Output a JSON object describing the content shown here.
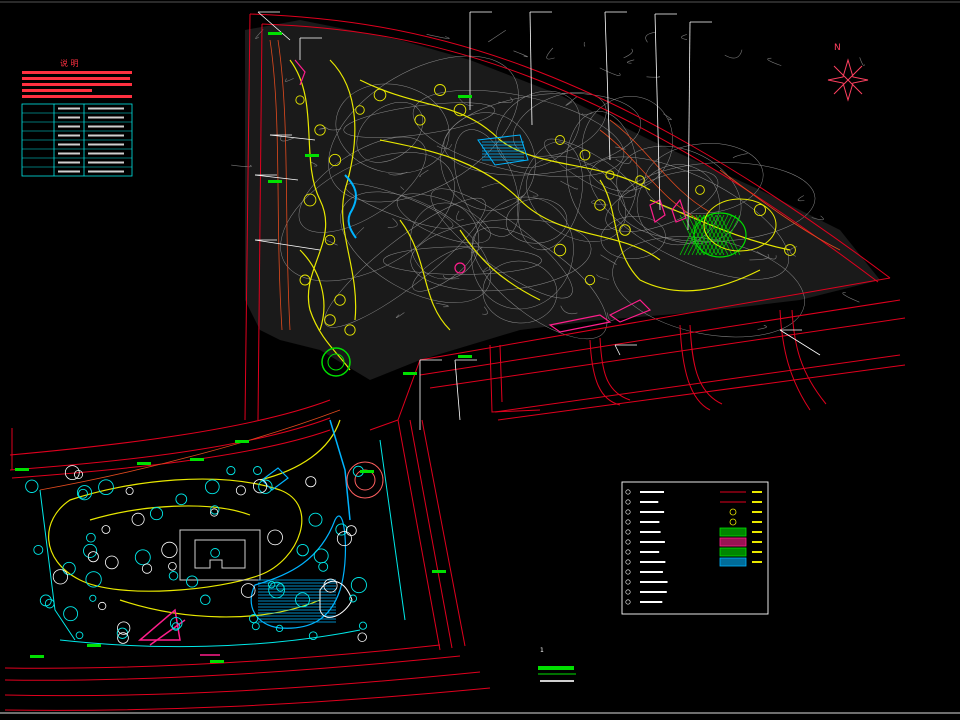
{
  "drawing": {
    "north_label": "N",
    "notes_title": "说 明",
    "table_rows": [
      [
        "",
        "",
        ""
      ],
      [
        "",
        "",
        ""
      ],
      [
        "",
        "",
        ""
      ],
      [
        "",
        "",
        ""
      ],
      [
        "",
        "",
        ""
      ],
      [
        "",
        "",
        ""
      ],
      [
        "",
        "",
        ""
      ],
      [
        "",
        "",
        ""
      ]
    ],
    "legend_title": "",
    "legend_rows": 12,
    "page_marker": "1",
    "callout_count": 14
  },
  "colors": {
    "background": "#000000",
    "boundary": "#e0001e",
    "contour": "#8a8a8a",
    "path": "#e8e800",
    "water": "#00b4ff",
    "vegetation": "#00e000",
    "tree": "#e8e800",
    "accent": "#ff1e8c",
    "text": "#ffffff",
    "cyan": "#00e8e8",
    "magenta": "#ff40ff"
  }
}
